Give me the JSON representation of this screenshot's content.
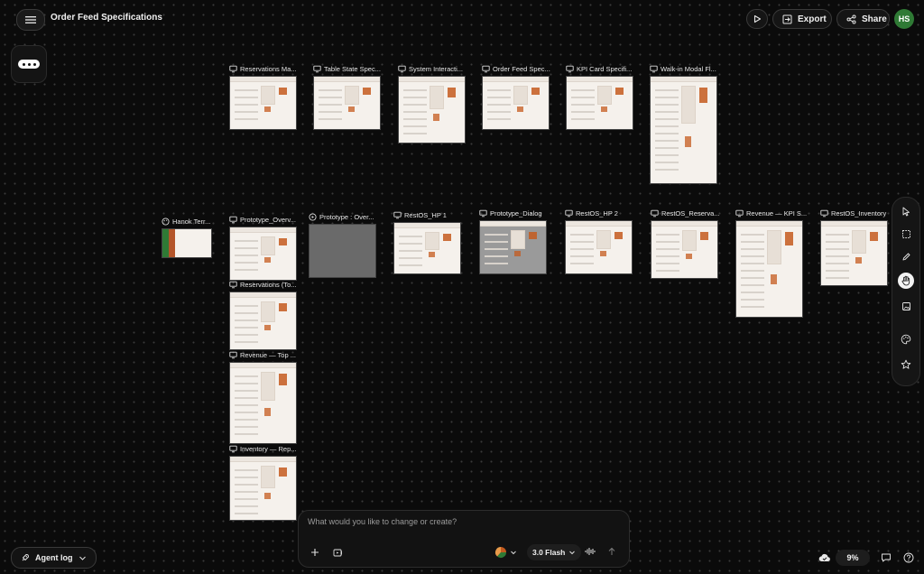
{
  "header": {
    "title": "Order Feed Specifications",
    "export_label": "Export",
    "share_label": "Share",
    "avatar_initials": "HS"
  },
  "frames": [
    {
      "label": "Reservations Ma...",
      "kind": "screen"
    },
    {
      "label": "Table State Spec...",
      "kind": "screen"
    },
    {
      "label": "System Interacti...",
      "kind": "screen"
    },
    {
      "label": "Order Feed Spec...",
      "kind": "screen"
    },
    {
      "label": "KPI Card Specifi...",
      "kind": "screen"
    },
    {
      "label": "Walk-in Modal Fl...",
      "kind": "screen"
    },
    {
      "label": "Hanok Terr...",
      "kind": "palette"
    },
    {
      "label": "Prototype_Overv...",
      "kind": "screen"
    },
    {
      "label": "Prototype : Over...",
      "kind": "prototype"
    },
    {
      "label": "RestOS_HP 1",
      "kind": "screen"
    },
    {
      "label": "Prototype_Dialog",
      "kind": "screen"
    },
    {
      "label": "RestOS_HP 2",
      "kind": "screen"
    },
    {
      "label": "RestOS_Reserva...",
      "kind": "screen"
    },
    {
      "label": "Revenue — KPI S...",
      "kind": "screen"
    },
    {
      "label": "RestOS_Inventory",
      "kind": "screen"
    },
    {
      "label": "Reservations (To...",
      "kind": "screen"
    },
    {
      "label": "Revenue — Top ...",
      "kind": "screen"
    },
    {
      "label": "Inventory — Rep...",
      "kind": "screen"
    }
  ],
  "chat": {
    "placeholder": "What would you like to change or create?",
    "model_label": "3.0 Flash"
  },
  "footer": {
    "agent_log_label": "Agent log",
    "zoom_label": "9%"
  },
  "colors": {
    "accent": "#c45a1e",
    "canvas": "#0b0b0b",
    "avatar": "#2f7a35"
  },
  "icons": {
    "menu": "hamburger-icon",
    "play": "play-icon",
    "export": "export-icon",
    "share": "share-icon",
    "tools": [
      "cursor-icon",
      "marquee-select-icon",
      "pencil-icon",
      "hand-icon",
      "image-icon",
      "palette-icon",
      "star-icon"
    ]
  }
}
